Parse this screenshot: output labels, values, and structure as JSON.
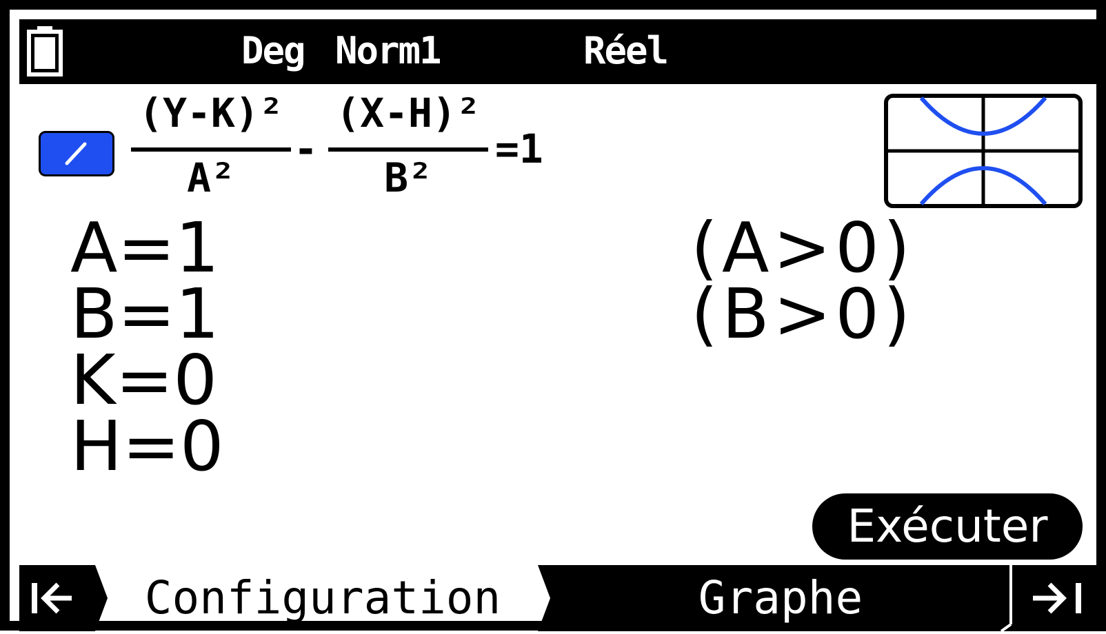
{
  "status_bar": {
    "angle_mode": "Deg",
    "display_mode": "Norm1",
    "complex_mode": "Réel",
    "battery_icon": "battery-icon"
  },
  "formula": {
    "numerator_1": "(Y-K)²",
    "denominator_1": "A²",
    "operator": "-",
    "numerator_2": "(X-H)²",
    "denominator_2": "B²",
    "rhs": "=1",
    "edit_icon": "pencil-icon",
    "edit_color": "#1f4ff0"
  },
  "preview": {
    "graph_color": "#1f4ff0"
  },
  "variables": [
    {
      "label": "A=1"
    },
    {
      "label": "B=1"
    },
    {
      "label": "K=0"
    },
    {
      "label": "H=0"
    }
  ],
  "conditions": [
    {
      "label": "(A>0)"
    },
    {
      "label": "(B>0)"
    }
  ],
  "actions": {
    "execute_label": "Exécuter"
  },
  "bottom_tabs": {
    "first_icon": "jump-to-start-icon",
    "configuration_label": "Configuration",
    "graph_label": "Graphe",
    "last_icon": "jump-to-end-icon"
  }
}
